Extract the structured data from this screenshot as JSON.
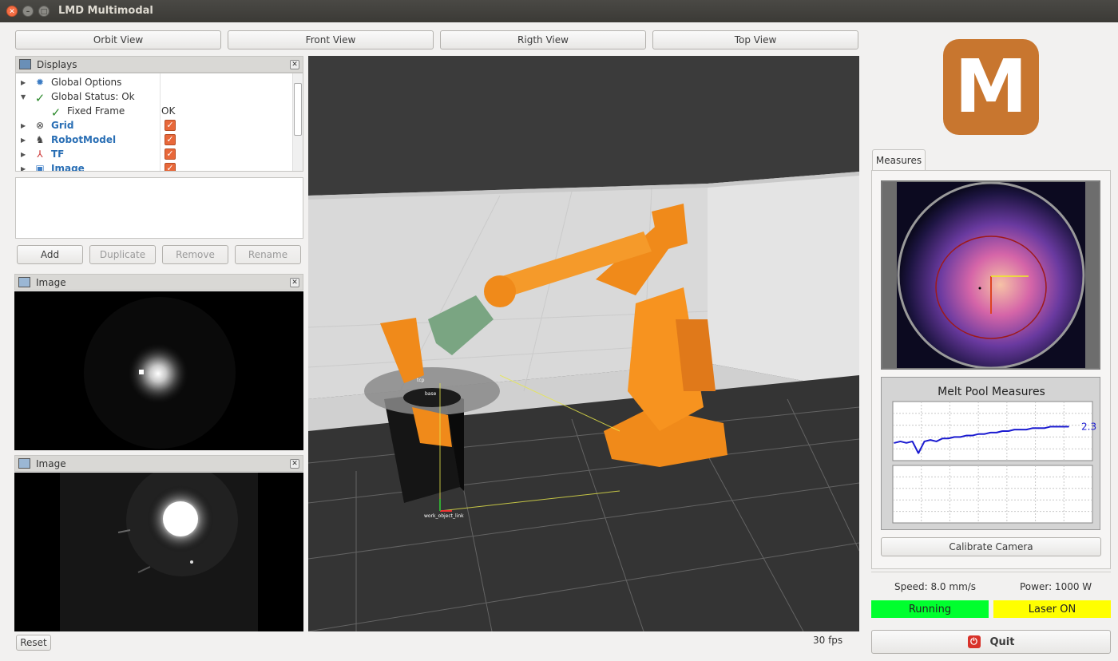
{
  "window": {
    "title": "LMD Multimodal"
  },
  "view_buttons": [
    "Orbit View",
    "Front View",
    "Rigth View",
    "Top View"
  ],
  "displays": {
    "title": "Displays",
    "items": [
      {
        "label": "Global Options",
        "value": ""
      },
      {
        "label": "Global Status: Ok",
        "value": ""
      },
      {
        "label": "Fixed Frame",
        "value": "OK"
      },
      {
        "label": "Grid",
        "checked": true
      },
      {
        "label": "RobotModel",
        "checked": true
      },
      {
        "label": "TF",
        "checked": true
      },
      {
        "label": "Image",
        "checked": true
      }
    ],
    "buttons": [
      "Add",
      "Duplicate",
      "Remove",
      "Rename"
    ]
  },
  "image_panels": [
    {
      "title": "Image"
    },
    {
      "title": "Image"
    }
  ],
  "viewport": {
    "frame_labels": [
      "tcp",
      "base",
      "work_object_link"
    ]
  },
  "bottom": {
    "reset_label": "Reset",
    "fps": "30 fps"
  },
  "logo": {
    "letter": "M",
    "color": "#c8762f"
  },
  "measures": {
    "tab_label": "Measures",
    "chart_title": "Melt Pool Measures",
    "current_value": "2.3",
    "calibrate_label": "Calibrate Camera"
  },
  "info": {
    "speed": "Speed: 8.0 mm/s",
    "power": "Power: 1000 W",
    "status_running": "Running",
    "status_laser": "Laser ON",
    "running_color": "#00ff2e",
    "laser_color": "#ffff00",
    "quit_label": "Quit"
  },
  "chart_data": {
    "type": "line",
    "title": "Melt Pool Measures",
    "series": [
      {
        "values": [
          1.2,
          1.3,
          1.2,
          1.3,
          0.5,
          1.3,
          1.4,
          1.3,
          1.5,
          1.5,
          1.6,
          1.6,
          1.7,
          1.7,
          1.8,
          1.8,
          1.9,
          1.9,
          2.0,
          2.0,
          2.1,
          2.1,
          2.1,
          2.2,
          2.2,
          2.2,
          2.3,
          2.3,
          2.3,
          2.3
        ]
      }
    ],
    "last_value_label": "2.3",
    "grid": true,
    "ylim": [
      0,
      4
    ]
  }
}
